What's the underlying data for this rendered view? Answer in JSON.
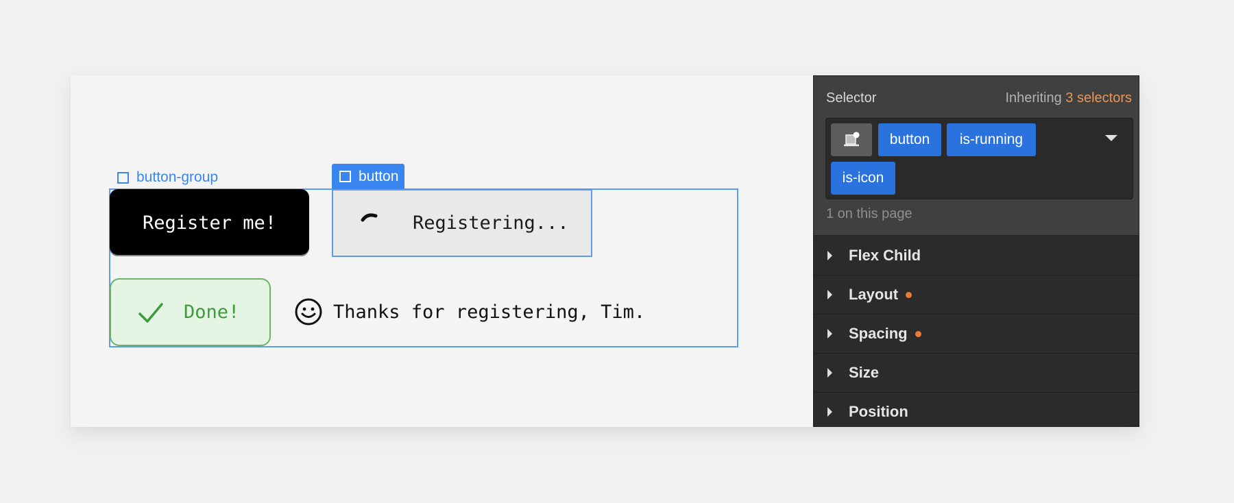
{
  "canvas": {
    "group_label": "button-group",
    "active_label": "button",
    "register_button": "Register me!",
    "running_button": "Registering...",
    "done_button": "Done!",
    "thanks_message": "Thanks for registering, Tim.",
    "icons": {
      "spinner": "spinner-icon",
      "check": "check-icon",
      "smile": "smile-icon",
      "element": "square-element-icon"
    }
  },
  "panel": {
    "selector_title": "Selector",
    "inheriting_prefix": "Inheriting",
    "inheriting_count": "3 selectors",
    "state_icon": "element-state-icon",
    "chips": [
      "button",
      "is-running",
      "is-icon"
    ],
    "on_page": "1 on this page",
    "sections": [
      {
        "label": "Flex Child",
        "modified": false
      },
      {
        "label": "Layout",
        "modified": true
      },
      {
        "label": "Spacing",
        "modified": true
      },
      {
        "label": "Size",
        "modified": false
      },
      {
        "label": "Position",
        "modified": false
      }
    ]
  },
  "colors": {
    "selection_blue": "#3a86f0",
    "chip_blue": "#2a72de",
    "modified_dot": "#ea7d35",
    "success_green": "#3f9a3c",
    "inherit_accent": "#e8965a"
  }
}
